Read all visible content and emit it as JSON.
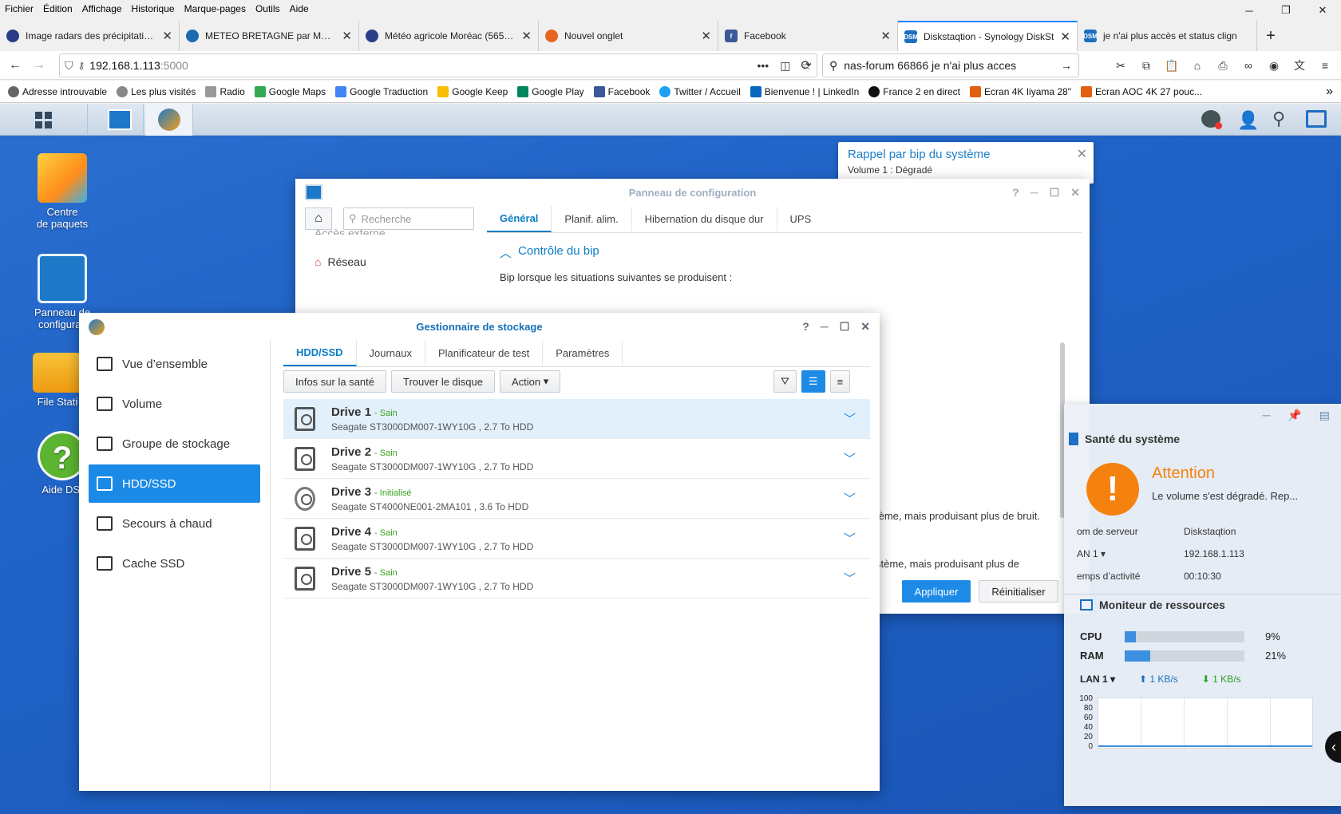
{
  "menubar": [
    "Fichier",
    "Édition",
    "Affichage",
    "Historique",
    "Marque-pages",
    "Outils",
    "Aide"
  ],
  "tabs": [
    {
      "label": "Image radars des précipitations",
      "color": "#2b3d88"
    },
    {
      "label": "METEO BRETAGNE par Météo-F",
      "color": "#1c6bb0"
    },
    {
      "label": "Météo agricole Moréac (56500)",
      "color": "#2b3d88"
    },
    {
      "label": "Nouvel onglet",
      "color": "#e8651d"
    },
    {
      "label": "Facebook",
      "color": "#3b5998"
    },
    {
      "label": "Diskstaqtion - Synology DiskSt",
      "color": "#1b6fc2",
      "active": true
    },
    {
      "label": "je n'ai plus accès et status clign",
      "color": "#1b6fc2"
    }
  ],
  "url": {
    "host": "192.168.1.113",
    "port": ":5000"
  },
  "search": {
    "value": "nas-forum 66866 je n'ai plus acces"
  },
  "bookmarks": [
    {
      "label": "Adresse introuvable",
      "color": "#555"
    },
    {
      "label": "Les plus visités",
      "color": "#777"
    },
    {
      "label": "Radio",
      "color": "#888"
    },
    {
      "label": "Google Maps",
      "color": "#34a853"
    },
    {
      "label": "Google Traduction",
      "color": "#4285f4"
    },
    {
      "label": "Google Keep",
      "color": "#fbbc04"
    },
    {
      "label": "Google Play",
      "color": "#01875f"
    },
    {
      "label": "Facebook",
      "color": "#3b5998"
    },
    {
      "label": "Twitter / Accueil",
      "color": "#1da1f2"
    },
    {
      "label": "Bienvenue ! | LinkedIn",
      "color": "#0a66c2"
    },
    {
      "label": "France 2 en direct",
      "color": "#111"
    },
    {
      "label": "Ecran 4K Iiyama 28\"",
      "color": "#e06010"
    },
    {
      "label": "Ecran AOC 4K 27 pouc...",
      "color": "#e06010"
    }
  ],
  "desktop": {
    "icons": [
      "Centre\nde paquets",
      "Panneau de\nconfigurati",
      "File Stati",
      "Aide DSI"
    ]
  },
  "notification": {
    "title": "Rappel par bip du système",
    "message": "Volume 1 : Dégradé"
  },
  "config": {
    "title": "Panneau de configuration",
    "search_placeholder": "Recherche",
    "side": [
      "Accès externe",
      "Réseau"
    ],
    "tabs": [
      "Général",
      "Planif. alim.",
      "Hibernation du disque dur",
      "UPS"
    ],
    "section": "Contrôle du bip",
    "intro": "Bip lorsque les situations suivantes se produisent :",
    "line1": "ystème, mais produisant plus de bruit.",
    "line2": "système, mais produisant plus de",
    "apply": "Appliquer",
    "reset": "Réinitialiser"
  },
  "storage": {
    "title": "Gestionnaire de stockage",
    "side": [
      "Vue d’ensemble",
      "Volume",
      "Groupe de stockage",
      "HDD/SSD",
      "Secours à chaud",
      "Cache SSD"
    ],
    "tabs": [
      "HDD/SSD",
      "Journaux",
      "Planificateur de test",
      "Paramètres"
    ],
    "buttons": {
      "health": "Infos sur la santé",
      "find": "Trouver le disque",
      "action": "Action"
    },
    "drives": [
      {
        "name": "Drive 1",
        "status": "- Sain",
        "model": "Seagate ST3000DM007-1WY10G , 2.7 To HDD"
      },
      {
        "name": "Drive 2",
        "status": "- Sain",
        "model": "Seagate ST3000DM007-1WY10G , 2.7 To HDD"
      },
      {
        "name": "Drive 3",
        "status": "- Initialisé",
        "model": "Seagate ST4000NE001-2MA101 , 3.6 To HDD"
      },
      {
        "name": "Drive 4",
        "status": "- Sain",
        "model": "Seagate ST3000DM007-1WY10G , 2.7 To HDD"
      },
      {
        "name": "Drive 5",
        "status": "- Sain",
        "model": "Seagate ST3000DM007-1WY10G , 2.7 To HDD"
      }
    ]
  },
  "health": {
    "title": "Santé du système",
    "status": "Attention",
    "message": "Le volume s'est dégradé. Rep...",
    "rows": [
      {
        "k": "om de serveur",
        "v": "Diskstaqtion"
      },
      {
        "k": "AN 1 ▾",
        "v": "192.168.1.113"
      },
      {
        "k": "emps d’activité",
        "v": "00:10:30"
      }
    ]
  },
  "monitor": {
    "title": "Moniteur de ressources",
    "cpu_label": "CPU",
    "cpu_value": "9%",
    "cpu_fraction": 0.09,
    "ram_label": "RAM",
    "ram_value": "21%",
    "ram_fraction": 0.21,
    "lan_label": "LAN 1 ▾",
    "up": "1 KB/s",
    "down": "1 KB/s",
    "y_ticks": [
      "100",
      "80",
      "60",
      "40",
      "20",
      "0"
    ]
  }
}
